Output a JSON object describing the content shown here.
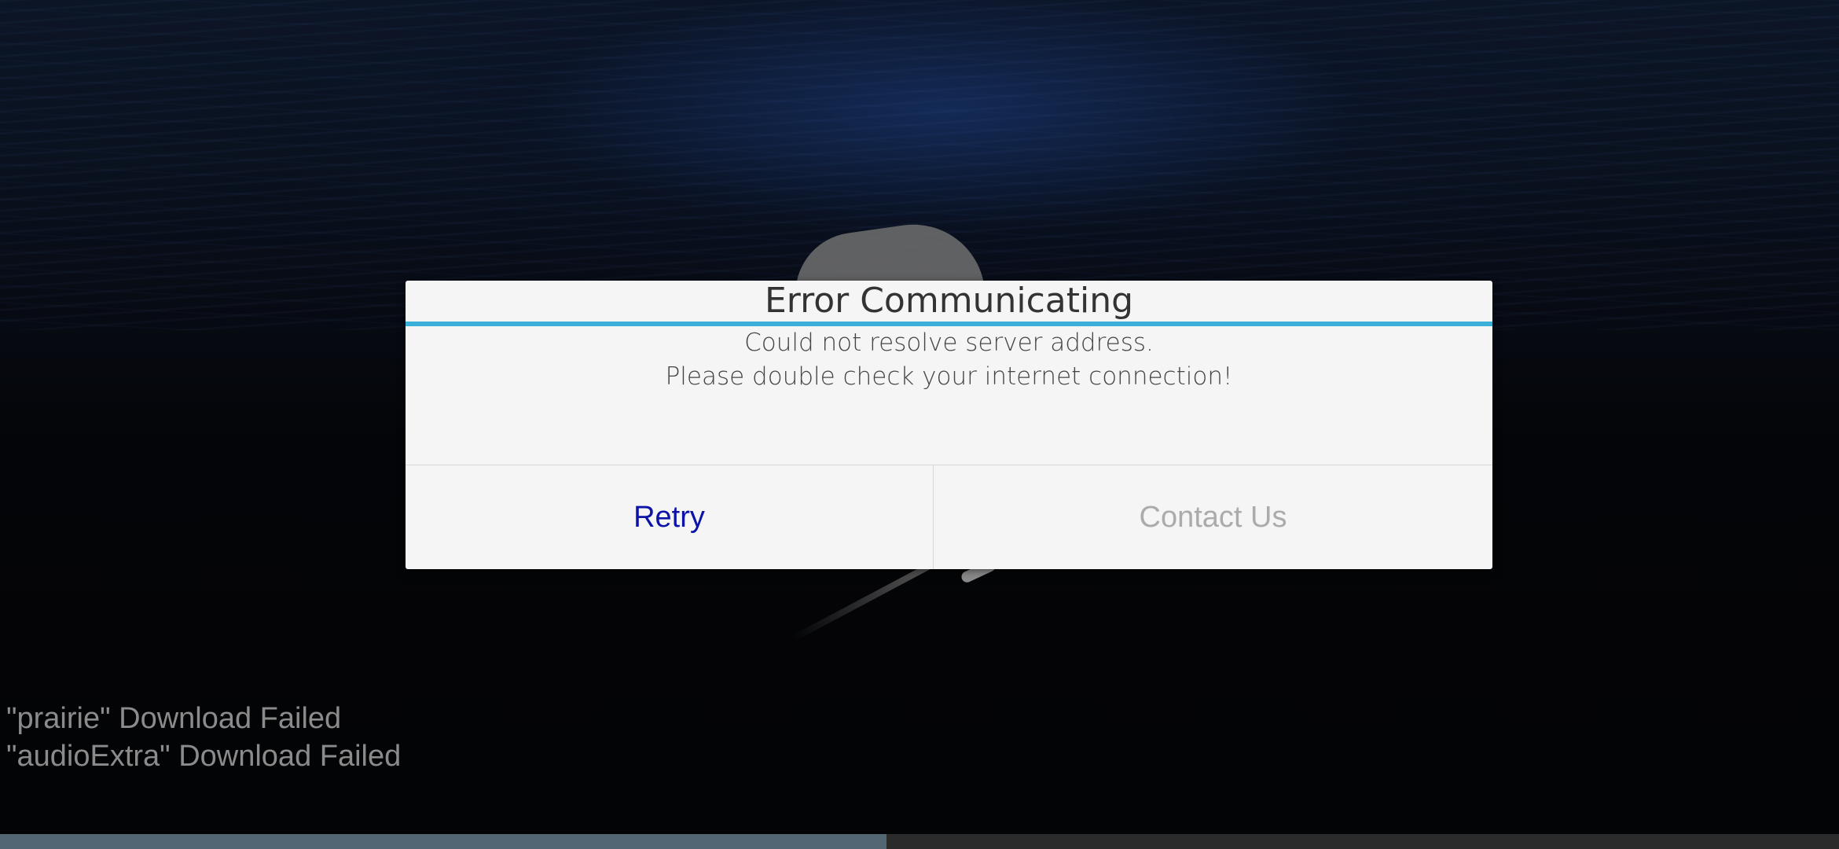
{
  "dialog": {
    "title": "Error Communicating",
    "message_lines": [
      "Could not resolve server address.",
      "Please double check your internet connection!"
    ],
    "buttons": {
      "retry": "Retry",
      "contact": "Contact Us"
    },
    "accent_color": "#3ab0d8",
    "retry_color": "#0c14a8",
    "contact_color": "#ababab"
  },
  "status_log": [
    "\"prairie\" Download Failed",
    "\"audioExtra\" Download Failed"
  ],
  "progress": {
    "fraction": 0.482,
    "fill_color": "#536674",
    "track_color": "#2b2b2b"
  },
  "background": {
    "description_icon": "app-logo-icon"
  }
}
